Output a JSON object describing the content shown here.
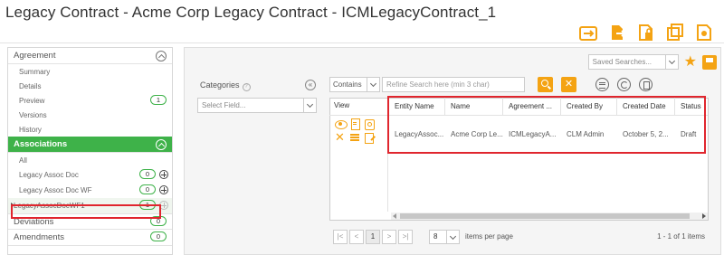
{
  "page": {
    "title": "Legacy Contract - Acme Corp Legacy Contract - ICMLegacyContract_1"
  },
  "top_actions": [
    "document-transfer-icon",
    "document-export-icon",
    "document-lock-icon",
    "document-copy-icon",
    "document-share-icon"
  ],
  "leftnav": {
    "agreement": {
      "label": "Agreement",
      "items": [
        {
          "label": "Summary"
        },
        {
          "label": "Details"
        },
        {
          "label": "Preview",
          "count": "1"
        },
        {
          "label": "Versions"
        },
        {
          "label": "History"
        }
      ]
    },
    "associations": {
      "label": "Associations",
      "items": [
        {
          "label": "All"
        },
        {
          "label": "Legacy Assoc Doc",
          "count": "0"
        },
        {
          "label": "Legacy Assoc Doc WF",
          "count": "0"
        },
        {
          "label": "LegacyAssocDocWF1",
          "count": "1"
        }
      ]
    },
    "deviations": {
      "label": "Deviations",
      "count": "0"
    },
    "amendments": {
      "label": "Amendments",
      "count": "0"
    }
  },
  "toolbar": {
    "saved_searches_placeholder": "Saved Searches..."
  },
  "categories": {
    "label": "Categories",
    "select_placeholder": "Select Field..."
  },
  "search": {
    "operator": "Contains",
    "placeholder": "Refine Search here (min 3 char)"
  },
  "grid": {
    "view_header": "View",
    "columns": [
      "Entity Name",
      "Name",
      "Agreement ...",
      "Created By",
      "Created Date",
      "Status"
    ],
    "rows": [
      [
        "LegacyAssoc...",
        "Acme Corp Le...",
        "ICMLegacyA...",
        "CLM Admin",
        "October 5, 2...",
        "Draft"
      ]
    ]
  },
  "pager": {
    "first": "|<",
    "prev": "<",
    "page": "1",
    "next": ">",
    "last": ">|",
    "page_size": "8",
    "page_size_label": "items per page",
    "info": "1 - 1 of 1 items"
  },
  "colors": {
    "accent": "#f4a313",
    "active_green": "#3eb249",
    "highlight_red": "#e0262e"
  }
}
